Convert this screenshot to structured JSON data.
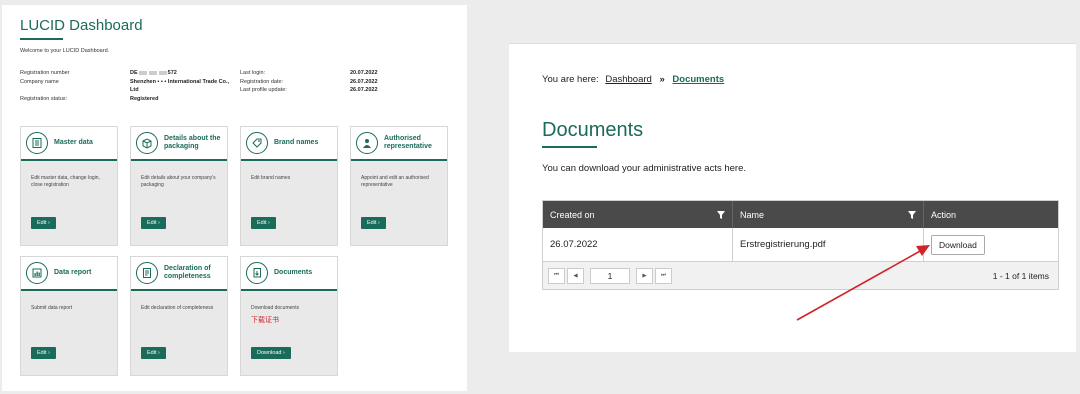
{
  "dashboard": {
    "title": "LUCID Dashboard",
    "welcome": "Welcome to your LUCID Dashboard.",
    "info_left": [
      {
        "label": "Registration number",
        "value_prefix": "DE",
        "value_suffix": "572"
      },
      {
        "label": "Company name",
        "value": "Shenzhen ▪ ▪ ▪ International Trade Co., Ltd"
      },
      {
        "label": "Registration status:",
        "value": "Registered"
      }
    ],
    "info_right": [
      {
        "label": "Last login:",
        "value": "20.07.2022"
      },
      {
        "label": "Registration date:",
        "value": "26.07.2022"
      },
      {
        "label": "Last profile update:",
        "value": "26.07.2022"
      }
    ],
    "cards": [
      {
        "title": "Master data",
        "desc": "Edit master data, change login, close registration",
        "button": "Edit ›",
        "icon": "building-icon"
      },
      {
        "title": "Details about the packaging",
        "desc": "Edit details about your company's packaging",
        "button": "Edit ›",
        "icon": "package-icon"
      },
      {
        "title": "Brand names",
        "desc": "Edit brand names",
        "button": "Edit ›",
        "icon": "tag-icon"
      },
      {
        "title": "Authorised representative",
        "desc": "Appoint and edit an authorised representative",
        "button": "Edit ›",
        "icon": "person-icon"
      },
      {
        "title": "Data report",
        "desc": "Submit data report",
        "button": "Edit ›",
        "icon": "report-icon"
      },
      {
        "title": "Declaration of completeness",
        "desc": "Edit declaration of completeness",
        "button": "Edit ›",
        "icon": "declaration-icon"
      },
      {
        "title": "Documents",
        "desc": "Download documents",
        "note": "下载证书",
        "button": "Download ›",
        "icon": "documents-icon"
      }
    ]
  },
  "documents_page": {
    "breadcrumb_prefix": "You are here:",
    "breadcrumb_home": "Dashboard",
    "breadcrumb_sep": "»",
    "breadcrumb_current": "Documents",
    "title": "Documents",
    "description": "You can download your administrative acts here.",
    "columns": [
      "Created on",
      "Name",
      "Action"
    ],
    "rows": [
      {
        "created": "26.07.2022",
        "name": "Erstregistrierung.pdf",
        "action": "Download"
      }
    ],
    "pager": {
      "page": "1",
      "info": "1 - 1 of 1 items",
      "first": "⏮",
      "prev": "◀",
      "next": "▶",
      "last": "⏭"
    }
  },
  "colors": {
    "brand": "#1a6b5a",
    "annotation": "#d0232a",
    "header_bg": "#4a4a4a"
  }
}
